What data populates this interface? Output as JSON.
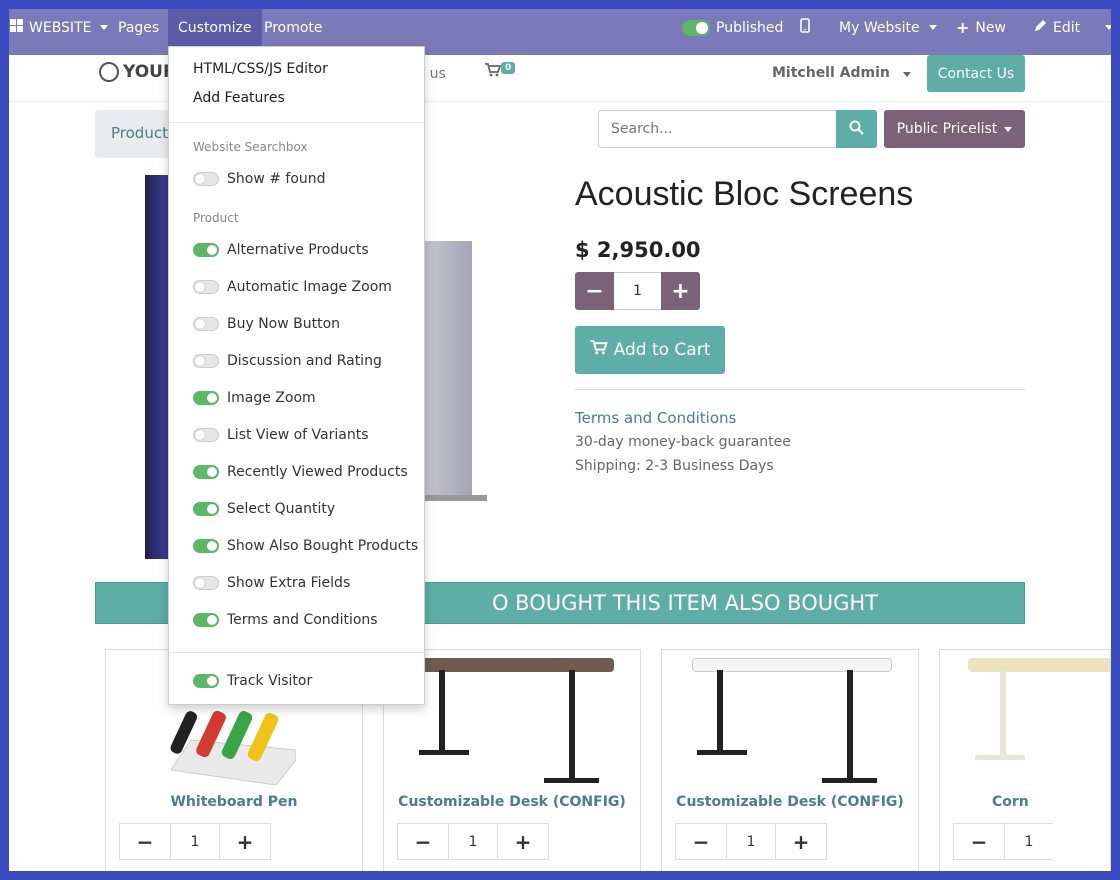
{
  "topbar": {
    "website": "WEBSITE",
    "pages": "Pages",
    "customize": "Customize",
    "promote": "Promote",
    "published": "Published",
    "my_website": "My Website",
    "new": "New",
    "edit": "Edit"
  },
  "header": {
    "logo_text": "YOUR",
    "contact_link": "ct us",
    "cart_count": "0",
    "user": "Mitchell Admin",
    "contact_button": "Contact Us"
  },
  "product": {
    "breadcrumb": "Products",
    "search_placeholder": "Search...",
    "pricelist": "Public Pricelist",
    "title": "Acoustic Bloc Screens",
    "price": "$ 2,950.00",
    "quantity": "1",
    "add_to_cart": "Add to Cart",
    "terms": "Terms and Conditions",
    "guarantee": "30-day money-back guarantee",
    "shipping": "Shipping: 2-3 Business Days"
  },
  "also_bought": "O BOUGHT THIS ITEM ALSO BOUGHT",
  "cards": [
    {
      "name": "Whiteboard Pen",
      "qty": "1"
    },
    {
      "name": "Customizable Desk (CONFIG)",
      "qty": "1"
    },
    {
      "name": "Customizable Desk (CONFIG)",
      "qty": "1"
    },
    {
      "name": "Corn",
      "qty": "1"
    }
  ],
  "dropdown": {
    "editor": "HTML/CSS/JS Editor",
    "add_features": "Add Features",
    "section_search": "Website Searchbox",
    "show_found": "Show # found",
    "section_product": "Product",
    "options": [
      {
        "label": "Alternative Products",
        "on": true
      },
      {
        "label": "Automatic Image Zoom",
        "on": false
      },
      {
        "label": "Buy Now Button",
        "on": false
      },
      {
        "label": "Discussion and Rating",
        "on": false
      },
      {
        "label": "Image Zoom",
        "on": true
      },
      {
        "label": "List View of Variants",
        "on": false
      },
      {
        "label": "Recently Viewed Products",
        "on": true
      },
      {
        "label": "Select Quantity",
        "on": true
      },
      {
        "label": "Show Also Bought Products",
        "on": true
      },
      {
        "label": "Show Extra Fields",
        "on": false
      },
      {
        "label": "Terms and Conditions",
        "on": true
      }
    ],
    "track_visitor": "Track Visitor"
  },
  "colors": {
    "topbar": "#7a7ab9",
    "accent": "#5eaea7",
    "secondary": "#7b6278",
    "toggle_on": "#5bb867"
  }
}
